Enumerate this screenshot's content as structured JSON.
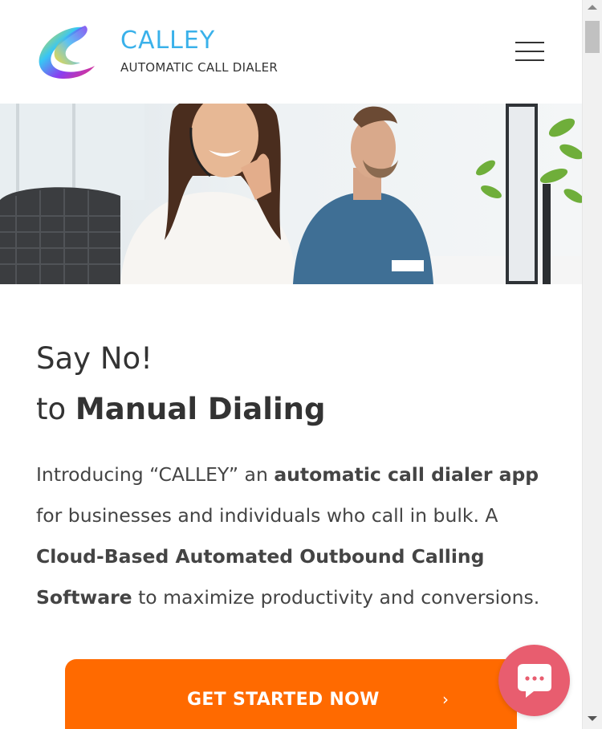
{
  "header": {
    "brand_name": "CALLEY",
    "brand_tagline": "AUTOMATIC CALL DIALER",
    "logo_icon": "calley-swirl-logo",
    "menu_icon": "hamburger-menu-icon"
  },
  "hero": {
    "image": "call-center-agents-with-headsets-photo"
  },
  "main": {
    "headline_line1": "Say No!",
    "headline_line2_prefix": "to ",
    "headline_line2_bold": "Manual Dialing",
    "intro_part1": "Introducing “CALLEY” an ",
    "intro_bold1": "automatic call dialer app",
    "intro_part2": " for businesses and individuals who call in bulk. A ",
    "intro_bold2": "Cloud-Based Automated Outbound Calling Software",
    "intro_part3": " to maximize productivity and conversions."
  },
  "cta": {
    "label": "GET STARTED NOW",
    "chevron": "›",
    "color": "#ff6a00"
  },
  "chat_widget": {
    "icon": "chat-bubble-icon",
    "color": "#e85d6f"
  },
  "colors": {
    "brand_blue": "#3ab1ea",
    "text_dark": "#333333"
  }
}
